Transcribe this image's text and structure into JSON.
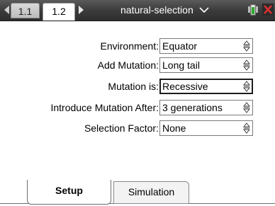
{
  "header": {
    "tabs": [
      {
        "label": "1.1",
        "active": false
      },
      {
        "label": "1.2",
        "active": true
      }
    ],
    "document_title": "natural-selection",
    "icons": [
      "nav-left-icon",
      "nav-right-icon",
      "chevron-down-icon",
      "battery-icon",
      "close-icon"
    ]
  },
  "form": {
    "fields": [
      {
        "label": "Environment:",
        "value": "Equator",
        "focused": false
      },
      {
        "label": "Add Mutation:",
        "value": "Long tail",
        "focused": false
      },
      {
        "label": "Mutation is:",
        "value": "Recessive",
        "focused": true
      },
      {
        "label": "Introduce Mutation After:",
        "value": "3 generations",
        "focused": false
      },
      {
        "label": "Selection Factor:",
        "value": "None",
        "focused": false
      }
    ]
  },
  "bottom_tabs": [
    {
      "label": "Setup",
      "active": true
    },
    {
      "label": "Simulation",
      "active": false
    }
  ],
  "colors": {
    "titlebar": "#3c3c3c",
    "battery_green": "#33aa33",
    "close_red": "#d93030"
  }
}
